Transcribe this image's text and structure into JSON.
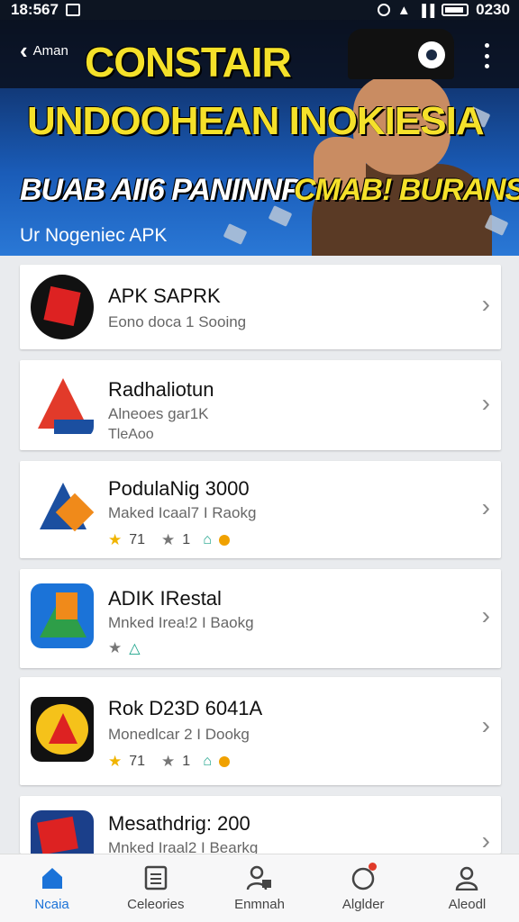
{
  "status_bar": {
    "time": "18:567",
    "battery_text": "0230"
  },
  "banner": {
    "back_label": "Aman",
    "title_line1": "CONSTAIR",
    "title_line2": "UNDOOHEAN INOKIESIA",
    "title_line3_white": "BUAB  AII6 PANINNP",
    "title_line3_yellow": "CMAB! BURANS",
    "subtitle": "Ur Nogeniec APK"
  },
  "apps": [
    {
      "name": "APK SAPRK",
      "sub": "Eono doca 1 Sooing",
      "colors": [
        "#111",
        "#d22"
      ]
    },
    {
      "name": "Radhaliotun",
      "sub": "Alneoes gar1K",
      "sub2": "TleAoo",
      "colors": [
        "#e23a2a",
        "#1b4fa0"
      ]
    },
    {
      "name": "PodulaNig 3000",
      "sub": "Maked Icaal7 I Raokg",
      "rating_a": "71",
      "rating_b": "1",
      "colors": [
        "#1b4fa0",
        "#f08a1a"
      ]
    },
    {
      "name": "ADIK IRestal",
      "sub": "Mnked Irea!2 I Baokg",
      "colors": [
        "#2e9e48",
        "#1b73d8"
      ]
    },
    {
      "name": "Rok D23D 6041A",
      "sub": "Monedlcar 2 I Dookg",
      "rating_a": "71",
      "rating_b": "1",
      "colors": [
        "#f5c21a",
        "#d22"
      ]
    },
    {
      "name": "Mesathdrig: 200",
      "sub": "Mnked Iraal2 I Bearkg",
      "colors": [
        "#1b3f8a",
        "#d22"
      ]
    }
  ],
  "bottom_nav": [
    {
      "label": "Ncaia",
      "icon": "home-icon",
      "active": true
    },
    {
      "label": "Celeories",
      "icon": "list-icon",
      "active": false
    },
    {
      "label": "Enmnah",
      "icon": "user-lock-icon",
      "active": false
    },
    {
      "label": "Alglder",
      "icon": "notification-icon",
      "active": false
    },
    {
      "label": "Aleodl",
      "icon": "profile-icon",
      "active": false
    }
  ],
  "colors": {
    "accent": "#1b73d8",
    "banner_yellow": "#f5e12a"
  }
}
